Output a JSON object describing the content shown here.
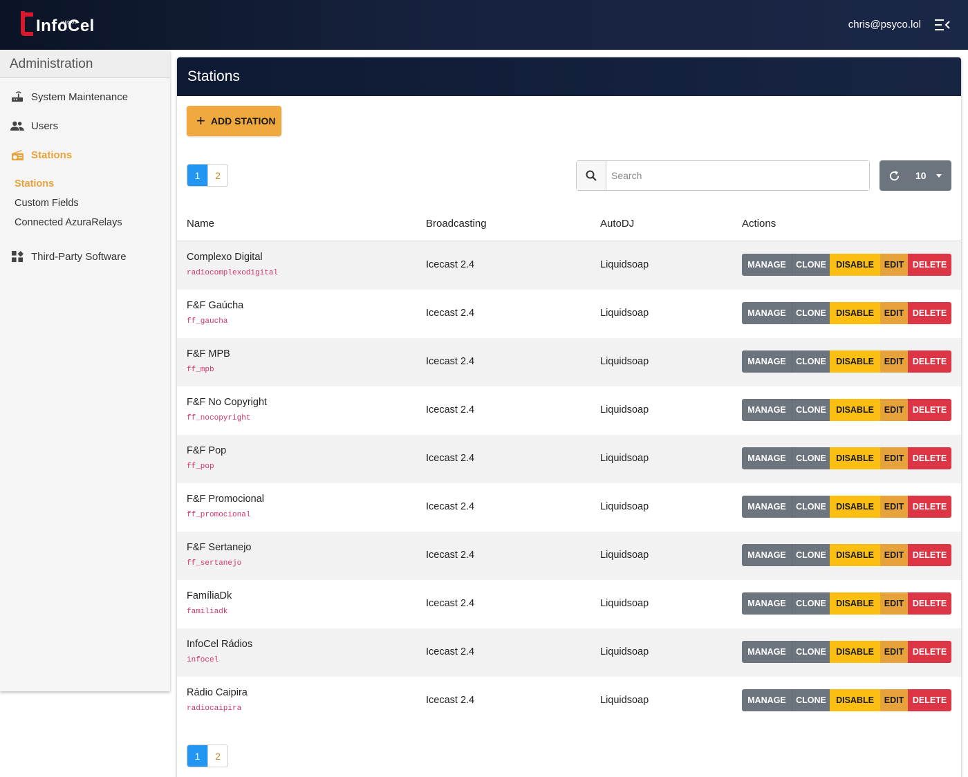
{
  "header": {
    "logo_text": "InfoCel",
    "logo_sub": "RÁDIOS",
    "user_email": "chris@psyco.lol"
  },
  "sidebar": {
    "title": "Administration",
    "items": [
      {
        "label": "System Maintenance",
        "icon": "router-icon"
      },
      {
        "label": "Users",
        "icon": "users-icon"
      },
      {
        "label": "Stations",
        "icon": "radio-icon",
        "active": true
      },
      {
        "label": "Third-Party Software",
        "icon": "widgets-icon"
      }
    ],
    "sub_items": [
      {
        "label": "Stations",
        "active": true
      },
      {
        "label": "Custom Fields"
      },
      {
        "label": "Connected AzuraRelays"
      }
    ]
  },
  "main": {
    "title": "Stations",
    "add_button": "ADD STATION",
    "pages": [
      "1",
      "2"
    ],
    "current_page": "1",
    "search_placeholder": "Search",
    "per_page": "10",
    "columns": [
      "Name",
      "Broadcasting",
      "AutoDJ",
      "Actions"
    ],
    "action_labels": {
      "manage": "MANAGE",
      "clone": "CLONE",
      "disable": "DISABLE",
      "edit": "EDIT",
      "delete": "DELETE"
    },
    "rows": [
      {
        "name": "Complexo Digital",
        "short": "radiocomplexodigital",
        "broadcasting": "Icecast 2.4",
        "autodj": "Liquidsoap"
      },
      {
        "name": "F&F Gaúcha",
        "short": "ff_gaucha",
        "broadcasting": "Icecast 2.4",
        "autodj": "Liquidsoap"
      },
      {
        "name": "F&F MPB",
        "short": "ff_mpb",
        "broadcasting": "Icecast 2.4",
        "autodj": "Liquidsoap"
      },
      {
        "name": "F&F No Copyright",
        "short": "ff_nocopyright",
        "broadcasting": "Icecast 2.4",
        "autodj": "Liquidsoap"
      },
      {
        "name": "F&F Pop",
        "short": "ff_pop",
        "broadcasting": "Icecast 2.4",
        "autodj": "Liquidsoap"
      },
      {
        "name": "F&F Promocional",
        "short": "ff_promocional",
        "broadcasting": "Icecast 2.4",
        "autodj": "Liquidsoap"
      },
      {
        "name": "F&F Sertanejo",
        "short": "ff_sertanejo",
        "broadcasting": "Icecast 2.4",
        "autodj": "Liquidsoap"
      },
      {
        "name": "FamíliaDk",
        "short": "familiadk",
        "broadcasting": "Icecast 2.4",
        "autodj": "Liquidsoap"
      },
      {
        "name": "InfoCel Rádios",
        "short": "infocel",
        "broadcasting": "Icecast 2.4",
        "autodj": "Liquidsoap"
      },
      {
        "name": "Rádio Caipira",
        "short": "radiocaipira",
        "broadcasting": "Icecast 2.4",
        "autodj": "Liquidsoap"
      }
    ]
  },
  "colors": {
    "accent": "#e7a33b",
    "header_bg": "#0e1a33",
    "primary": "#2196f3",
    "danger": "#dc3545",
    "warning": "#fbbf13",
    "secondary": "#6c757d"
  }
}
